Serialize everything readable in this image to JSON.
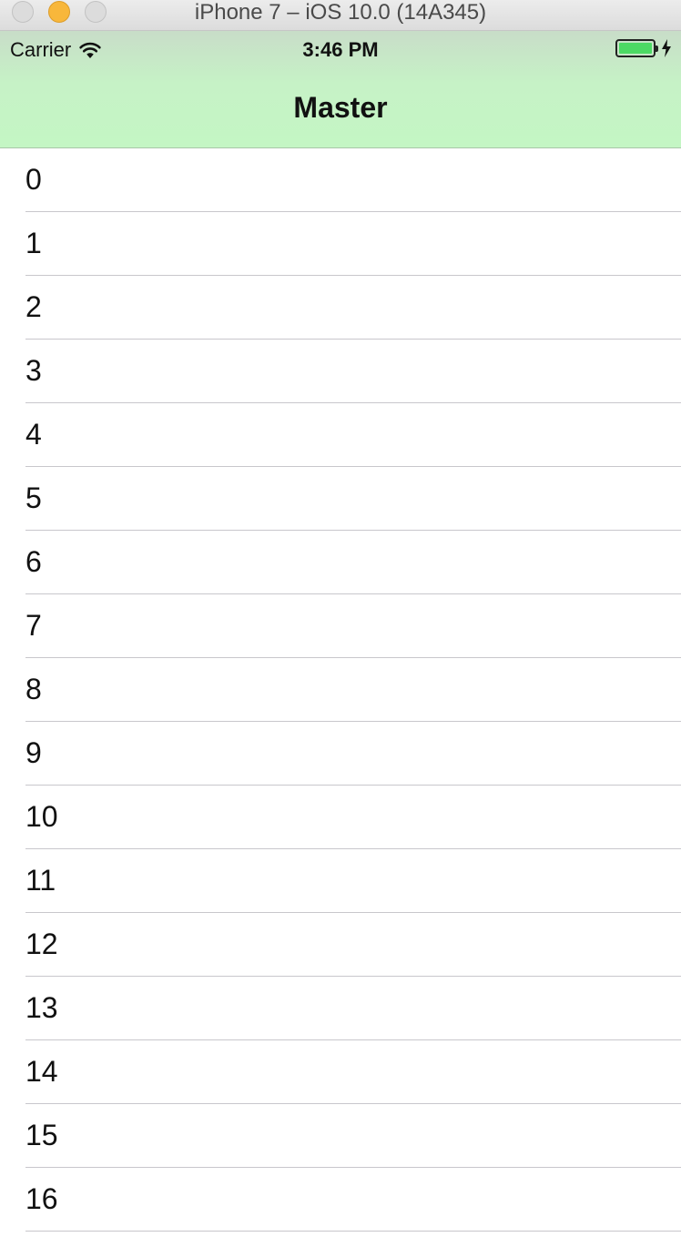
{
  "window": {
    "title": "iPhone 7 – iOS 10.0 (14A345)"
  },
  "status_bar": {
    "carrier": "Carrier",
    "time": "3:46 PM",
    "battery_level": 1.0,
    "charging": true,
    "icons": [
      "wifi-icon",
      "battery-icon",
      "charging-bolt-icon"
    ]
  },
  "nav": {
    "title": "Master",
    "bar_color": "#c4f6c4"
  },
  "table": {
    "rows": [
      {
        "label": "0"
      },
      {
        "label": "1"
      },
      {
        "label": "2"
      },
      {
        "label": "3"
      },
      {
        "label": "4"
      },
      {
        "label": "5"
      },
      {
        "label": "6"
      },
      {
        "label": "7"
      },
      {
        "label": "8"
      },
      {
        "label": "9"
      },
      {
        "label": "10"
      },
      {
        "label": "11"
      },
      {
        "label": "12"
      },
      {
        "label": "13"
      },
      {
        "label": "14"
      },
      {
        "label": "15"
      },
      {
        "label": "16"
      }
    ]
  },
  "colors": {
    "accent_green": "#4cd964",
    "separator": "#c8c7cc",
    "minimize_button": "#f8b73b"
  }
}
